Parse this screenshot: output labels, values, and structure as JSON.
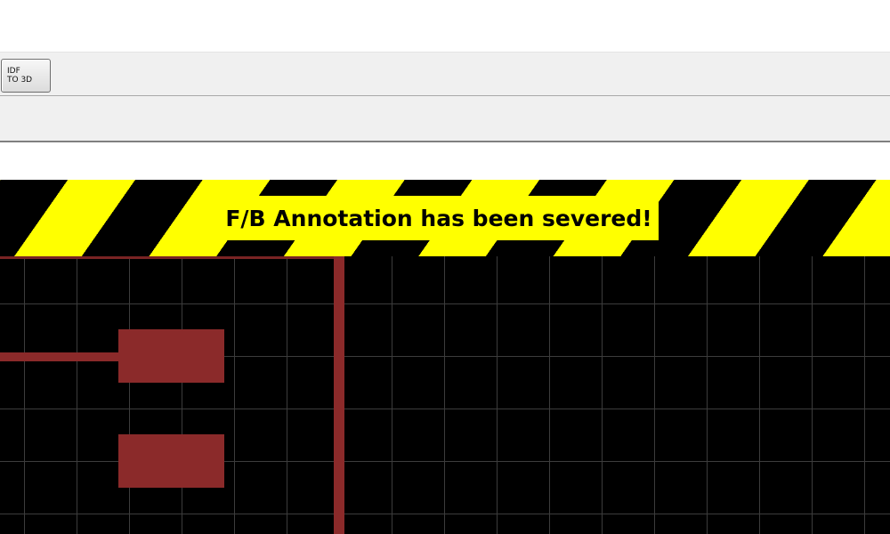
{
  "toolbar": {
    "idf_button": {
      "line1": "IDF",
      "line2": "TO 3D"
    }
  },
  "banner": {
    "message": "F/B Annotation has been severed!",
    "stripe_colors": [
      "#ffff00",
      "#000000"
    ]
  },
  "canvas": {
    "background_color": "#000000",
    "grid_color": "#3c3c3c",
    "copper_color": "#8b2a2a"
  }
}
